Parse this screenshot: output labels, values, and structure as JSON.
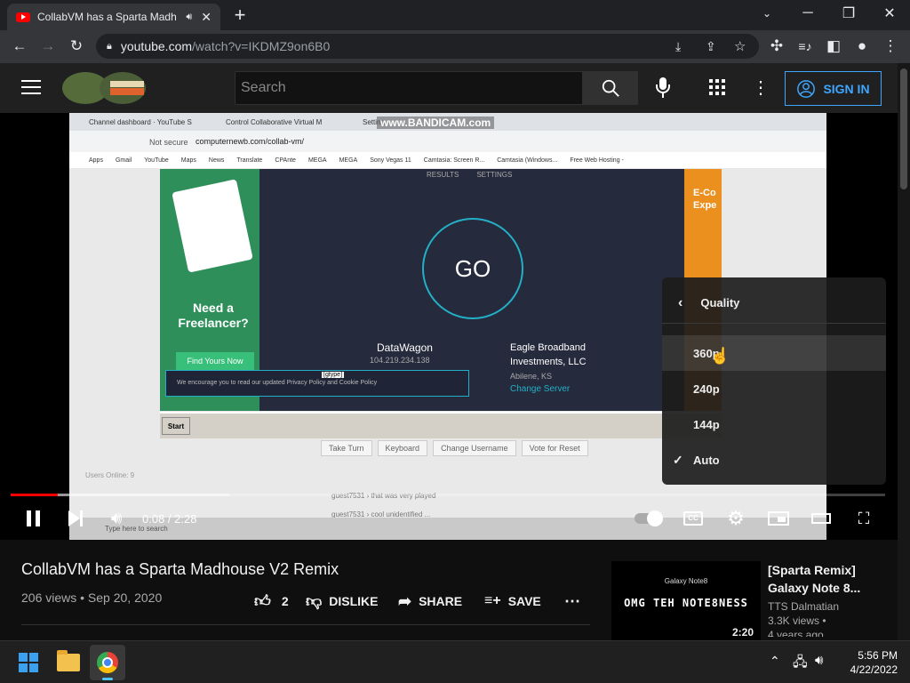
{
  "browser": {
    "tab_title": "CollabVM has a Sparta Madh",
    "new_tab": "+",
    "url_host": "youtube.com",
    "url_path": "/watch?v=IKDMZ9on6B0"
  },
  "youtube_header": {
    "search_placeholder": "Search",
    "sign_in": "SIGN IN"
  },
  "video_frame": {
    "inner_tabs": [
      "Channel dashboard · YouTube S",
      "Control Collaborative Virtual M",
      "Setting"
    ],
    "watermark": "www.BANDICAM.com",
    "inner_url_status": "Not secure",
    "inner_url": "computernewb.com/collab-vm/",
    "bookmarks": [
      "Apps",
      "Gmail",
      "YouTube",
      "Maps",
      "News",
      "Translate",
      "CPAnte",
      "MEGA",
      "MEGA",
      "Sony Vegas 11",
      "Camtasia: Screen R...",
      "Camtasia (Windows...",
      "Free Web Hosting -"
    ],
    "speedtest_tabs": [
      "RESULTS",
      "SETTINGS"
    ],
    "go_label": "GO",
    "ad_left_text": "Need a Freelancer?",
    "ad_left_button": "Find Yours Now",
    "ad_right_text": "E-Co Expe",
    "host_name": "DataWagon",
    "host_ip": "104.219.234.138",
    "isp_name": "Eagle Broadband Investments, LLC",
    "isp_location": "Abilene, KS",
    "change_server": "Change Server",
    "cookie_notice": "We encourage you to read our updated Privacy Policy and Cookie Policy",
    "tooltip": "[gtype]",
    "start_button": "Start",
    "vm_buttons": [
      "Take Turn",
      "Keyboard",
      "Change Username",
      "Vote for Reset"
    ],
    "users_online": "Users Online: 9",
    "chat_lines": [
      "guest7531 › that was very played",
      "guest7531 › cool unidentified ..."
    ],
    "win_search": "Type here to search"
  },
  "quality_menu": {
    "title": "Quality",
    "options": [
      "360p",
      "240p",
      "144p",
      "Auto"
    ],
    "selected": "Auto",
    "hovered": "360p"
  },
  "player": {
    "time": "0:08 / 2:28",
    "progress_fraction": 0.054,
    "buffered_fraction": 0.25
  },
  "video": {
    "title": "CollabVM has a Sparta Madhouse V2 Remix",
    "meta": "206 views • Sep 20, 2020",
    "likes": "2",
    "dislike": "DISLIKE",
    "share": "SHARE",
    "save": "SAVE"
  },
  "recommended": {
    "title": "[Sparta Remix] Galaxy Note 8...",
    "channel": "TTS Dalmatian",
    "views": "3.3K views •",
    "age": "4 years ago",
    "duration": "2:20",
    "thumb_top": "Galaxy Note8",
    "thumb_text": "OMG TEH NOTE8NESS"
  },
  "taskbar": {
    "time": "5:56 PM",
    "date": "4/22/2022"
  },
  "colors": {
    "youtube_red": "#ff0000",
    "sign_in_blue": "#3ea6ff",
    "speedtest_cyan": "#23b0c7"
  }
}
